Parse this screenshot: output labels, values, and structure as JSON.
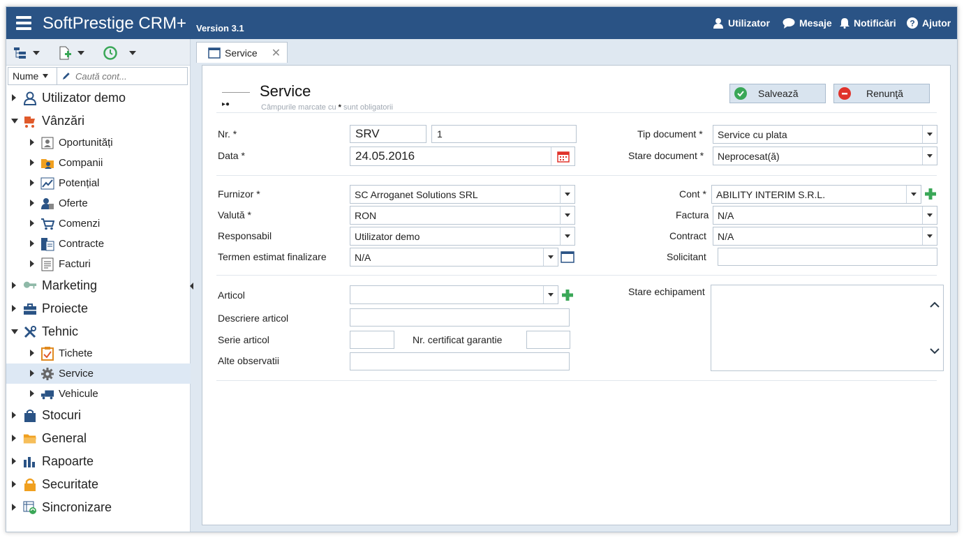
{
  "header": {
    "app_title": "SoftPrestige CRM+",
    "version": "Version 3.1",
    "user_label": "Utilizator",
    "messages_label": "Mesaje",
    "notifications_label": "Notificări",
    "help_label": "Ajutor",
    "bg_color": "#2a5385"
  },
  "sidebar": {
    "search": {
      "field_select": "Nume",
      "placeholder": "Caută cont..."
    },
    "tree": [
      {
        "label": "Utilizator demo"
      },
      {
        "label": "Vânzări",
        "children": [
          "Oportunități",
          "Companii",
          "Potențial",
          "Oferte",
          "Comenzi",
          "Contracte",
          "Facturi"
        ]
      },
      {
        "label": "Marketing"
      },
      {
        "label": "Proiecte"
      },
      {
        "label": "Tehnic",
        "children": [
          "Tichete",
          "Service",
          "Vehicule"
        ]
      },
      {
        "label": "Stocuri"
      },
      {
        "label": "General"
      },
      {
        "label": "Rapoarte"
      },
      {
        "label": "Securitate"
      },
      {
        "label": "Sincronizare"
      }
    ],
    "selected_item": "Service"
  },
  "tab": {
    "label": "Service"
  },
  "form": {
    "title": "Service",
    "required_note_prefix": "Câmpurile marcate cu",
    "required_note_star": "*",
    "required_note_suffix": "sunt obligatorii",
    "save_label": "Salvează",
    "cancel_label": "Renunţă",
    "fields": {
      "nr_label": "Nr. *",
      "nr_series": "SRV",
      "nr_number": "1",
      "data_label": "Data *",
      "data_value": "24.05.2016",
      "tip_doc_label": "Tip document *",
      "tip_doc_value": "Service cu plata",
      "stare_doc_label": "Stare document *",
      "stare_doc_value": "Neprocesat(ă)",
      "furnizor_label": "Furnizor *",
      "furnizor_value": "SC Arroganet Solutions SRL",
      "valuta_label": "Valută *",
      "valuta_value": "RON",
      "responsabil_label": "Responsabil",
      "responsabil_value": "Utilizator demo",
      "termen_label": "Termen estimat finalizare",
      "termen_value": "N/A",
      "cont_label": "Cont *",
      "cont_value": "ABILITY INTERIM S.R.L.",
      "factura_label": "Factura",
      "factura_value": "N/A",
      "contract_label": "Contract",
      "contract_value": "N/A",
      "solicitant_label": "Solicitant",
      "solicitant_value": "",
      "articol_label": "Articol",
      "articol_value": "",
      "descriere_label": "Descriere articol",
      "descriere_value": "",
      "serie_label": "Serie articol",
      "serie_value": "",
      "certificat_label": "Nr. certificat garantie",
      "certificat_value": "",
      "alte_label": "Alte observatii",
      "alte_value": "",
      "stare_echip_label": "Stare echipament",
      "stare_echip_value": ""
    }
  }
}
